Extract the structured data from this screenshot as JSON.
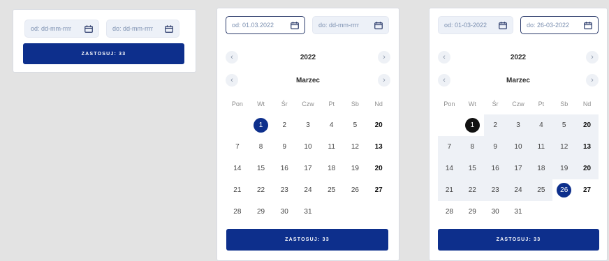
{
  "panel1": {
    "from_value": "od: dd-mm-rrrr",
    "to_value": "do: dd-mm-rrrr",
    "apply_label": "ZASTOSUJ: 33"
  },
  "panel2": {
    "from_value": "od: 01.03.2022",
    "to_value": "do: dd-mm-rrrr",
    "year": "2022",
    "month": "Marzec",
    "prev_year": "‹",
    "next_year": "›",
    "prev_month": "‹",
    "next_month": "›",
    "apply_label": "ZASTOSUJ: 33"
  },
  "panel3": {
    "from_value": "od: 01-03-2022",
    "to_value": "do: 26-03-2022",
    "year": "2022",
    "month": "Marzec",
    "prev_year": "‹",
    "next_year": "›",
    "prev_month": "‹",
    "next_month": "›",
    "apply_label": "ZASTOSUJ: 33"
  },
  "weekdays": [
    "Pon",
    "Wt",
    "Śr",
    "Czw",
    "Pt",
    "Sb",
    "Nd"
  ],
  "calendar_days": [
    [
      "",
      "1",
      "2",
      "3",
      "4",
      "5",
      "20"
    ],
    [
      "7",
      "8",
      "9",
      "10",
      "11",
      "12",
      "13"
    ],
    [
      "14",
      "15",
      "16",
      "17",
      "18",
      "19",
      "20"
    ],
    [
      "21",
      "22",
      "23",
      "24",
      "25",
      "26",
      "27"
    ],
    [
      "28",
      "29",
      "30",
      "31",
      "",
      "",
      ""
    ]
  ],
  "colors": {
    "primary": "#0d2f8c",
    "range_start": "#111111",
    "range_fill": "#eef1f6",
    "input_bg": "#edf1f8"
  },
  "icons": {
    "calendar": "calendar-icon",
    "prev": "chevron-left-icon",
    "next": "chevron-right-icon"
  }
}
